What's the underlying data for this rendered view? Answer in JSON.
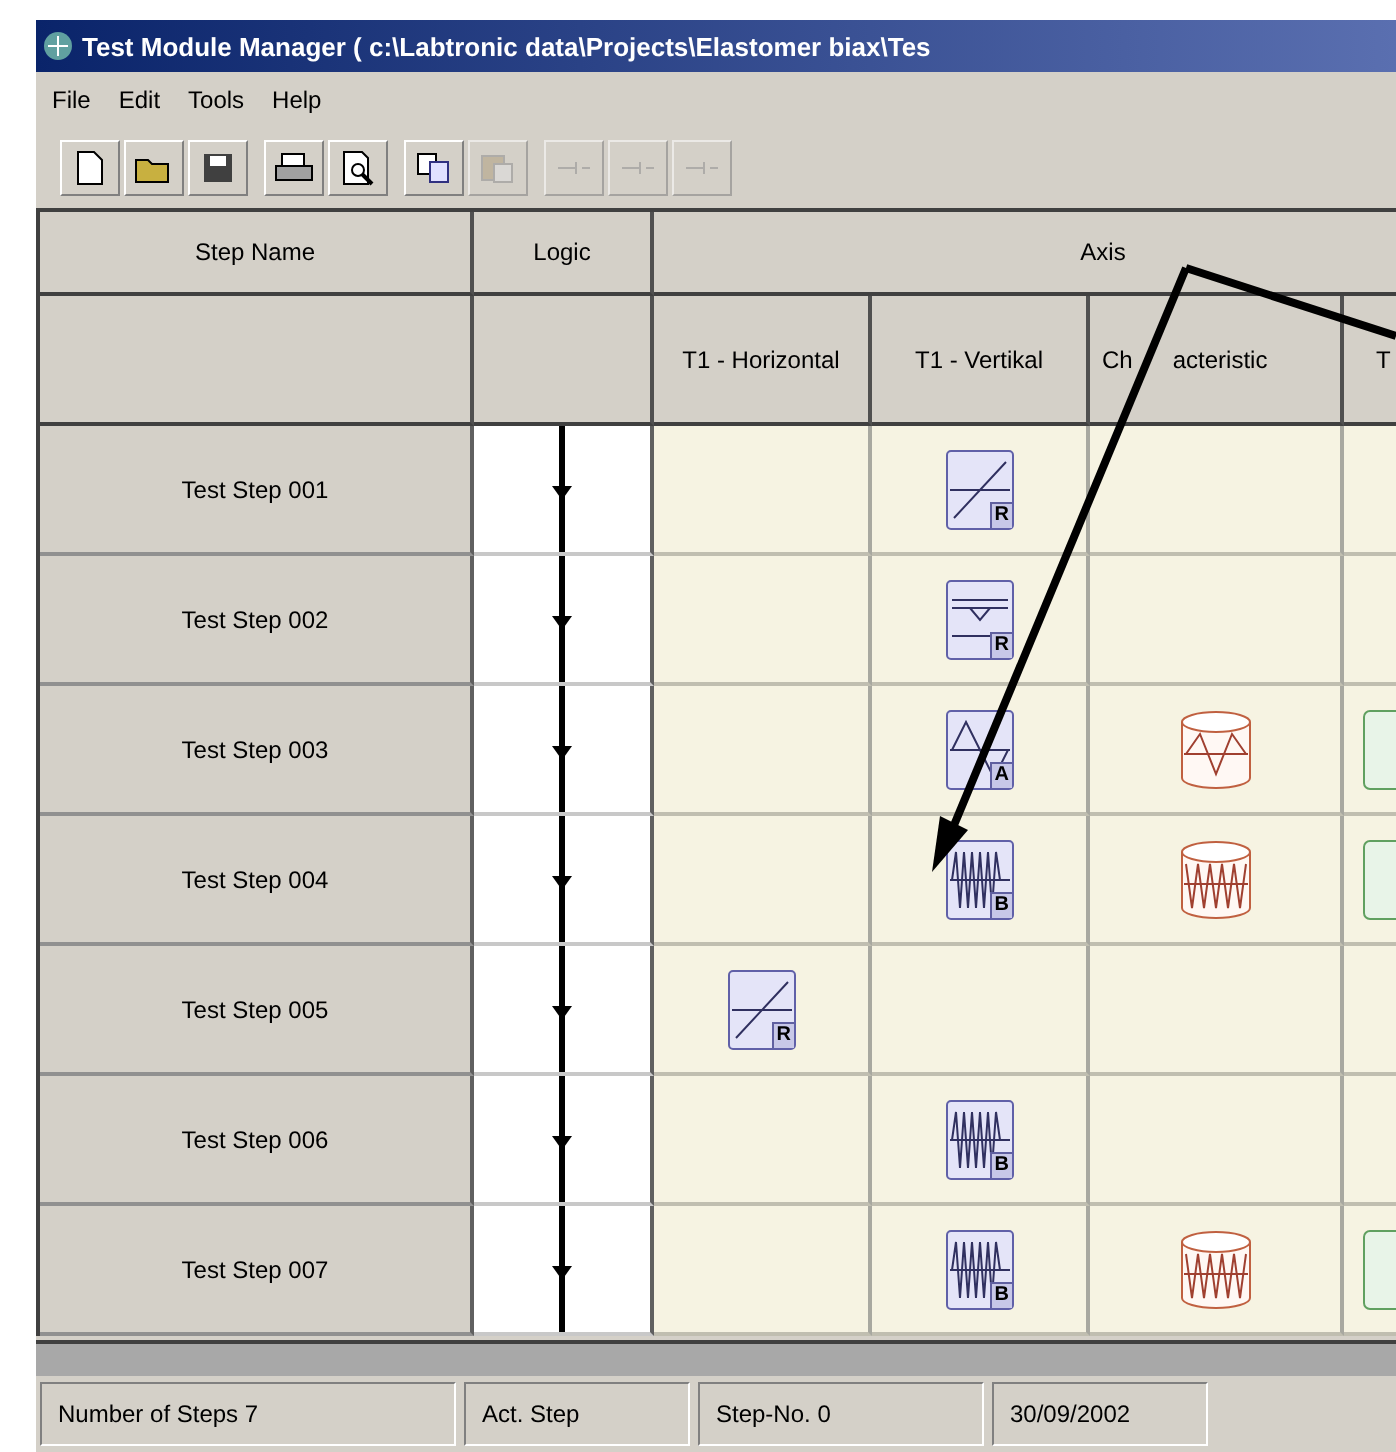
{
  "window": {
    "title": "Test Module Manager  ( c:\\Labtronic data\\Projects\\Elastomer biax\\Tes"
  },
  "menu": [
    {
      "label": "File"
    },
    {
      "label": "Edit"
    },
    {
      "label": "Tools"
    },
    {
      "label": "Help"
    }
  ],
  "toolbar": [
    {
      "kind": "new",
      "disabled": false
    },
    {
      "kind": "open",
      "disabled": false
    },
    {
      "kind": "save",
      "disabled": false
    },
    {
      "kind": "print",
      "disabled": false
    },
    {
      "kind": "preview",
      "disabled": false
    },
    {
      "kind": "copy",
      "disabled": false
    },
    {
      "kind": "paste",
      "disabled": true
    },
    {
      "kind": "step",
      "disabled": true
    },
    {
      "kind": "step",
      "disabled": true
    },
    {
      "kind": "step",
      "disabled": true
    }
  ],
  "table": {
    "columns": [
      {
        "label": "Step Name"
      },
      {
        "label": "Logic"
      },
      {
        "label": "Axis"
      }
    ],
    "subcolumns": [
      {
        "label": "T1 - Horizontal"
      },
      {
        "label": "T1 - Vertikal"
      },
      {
        "parts": [
          "Ch",
          "acteristic"
        ]
      },
      {
        "label": "T"
      }
    ],
    "rows": [
      {
        "name": "Test Step 001",
        "cells": [
          {
            "kind": "empty"
          },
          {
            "kind": "ramp",
            "badge": "R"
          },
          {
            "kind": "empty"
          },
          {
            "kind": "empty"
          }
        ]
      },
      {
        "name": "Test Step 002",
        "cells": [
          {
            "kind": "empty"
          },
          {
            "kind": "hold",
            "badge": "R"
          },
          {
            "kind": "empty"
          },
          {
            "kind": "empty"
          }
        ]
      },
      {
        "name": "Test Step 003",
        "cells": [
          {
            "kind": "empty"
          },
          {
            "kind": "triangle",
            "badge": "A"
          },
          {
            "kind": "drum-triangle"
          },
          {
            "kind": "green-card"
          }
        ]
      },
      {
        "name": "Test Step 004",
        "cells": [
          {
            "kind": "empty"
          },
          {
            "kind": "sine",
            "badge": "B"
          },
          {
            "kind": "drum-sine"
          },
          {
            "kind": "green-card"
          }
        ]
      },
      {
        "name": "Test Step 005",
        "cells": [
          {
            "kind": "ramp",
            "badge": "R"
          },
          {
            "kind": "empty"
          },
          {
            "kind": "empty"
          },
          {
            "kind": "empty"
          }
        ]
      },
      {
        "name": "Test Step 006",
        "cells": [
          {
            "kind": "empty"
          },
          {
            "kind": "sine",
            "badge": "B"
          },
          {
            "kind": "empty"
          },
          {
            "kind": "empty"
          }
        ]
      },
      {
        "name": "Test Step 007",
        "cells": [
          {
            "kind": "empty"
          },
          {
            "kind": "sine",
            "badge": "B"
          },
          {
            "kind": "drum-sine"
          },
          {
            "kind": "green-card"
          }
        ]
      }
    ]
  },
  "status_bar": [
    {
      "text": "Number of Steps 7"
    },
    {
      "text": "Act. Step"
    },
    {
      "text": "Step-No. 0"
    },
    {
      "text": "30/09/2002"
    }
  ]
}
